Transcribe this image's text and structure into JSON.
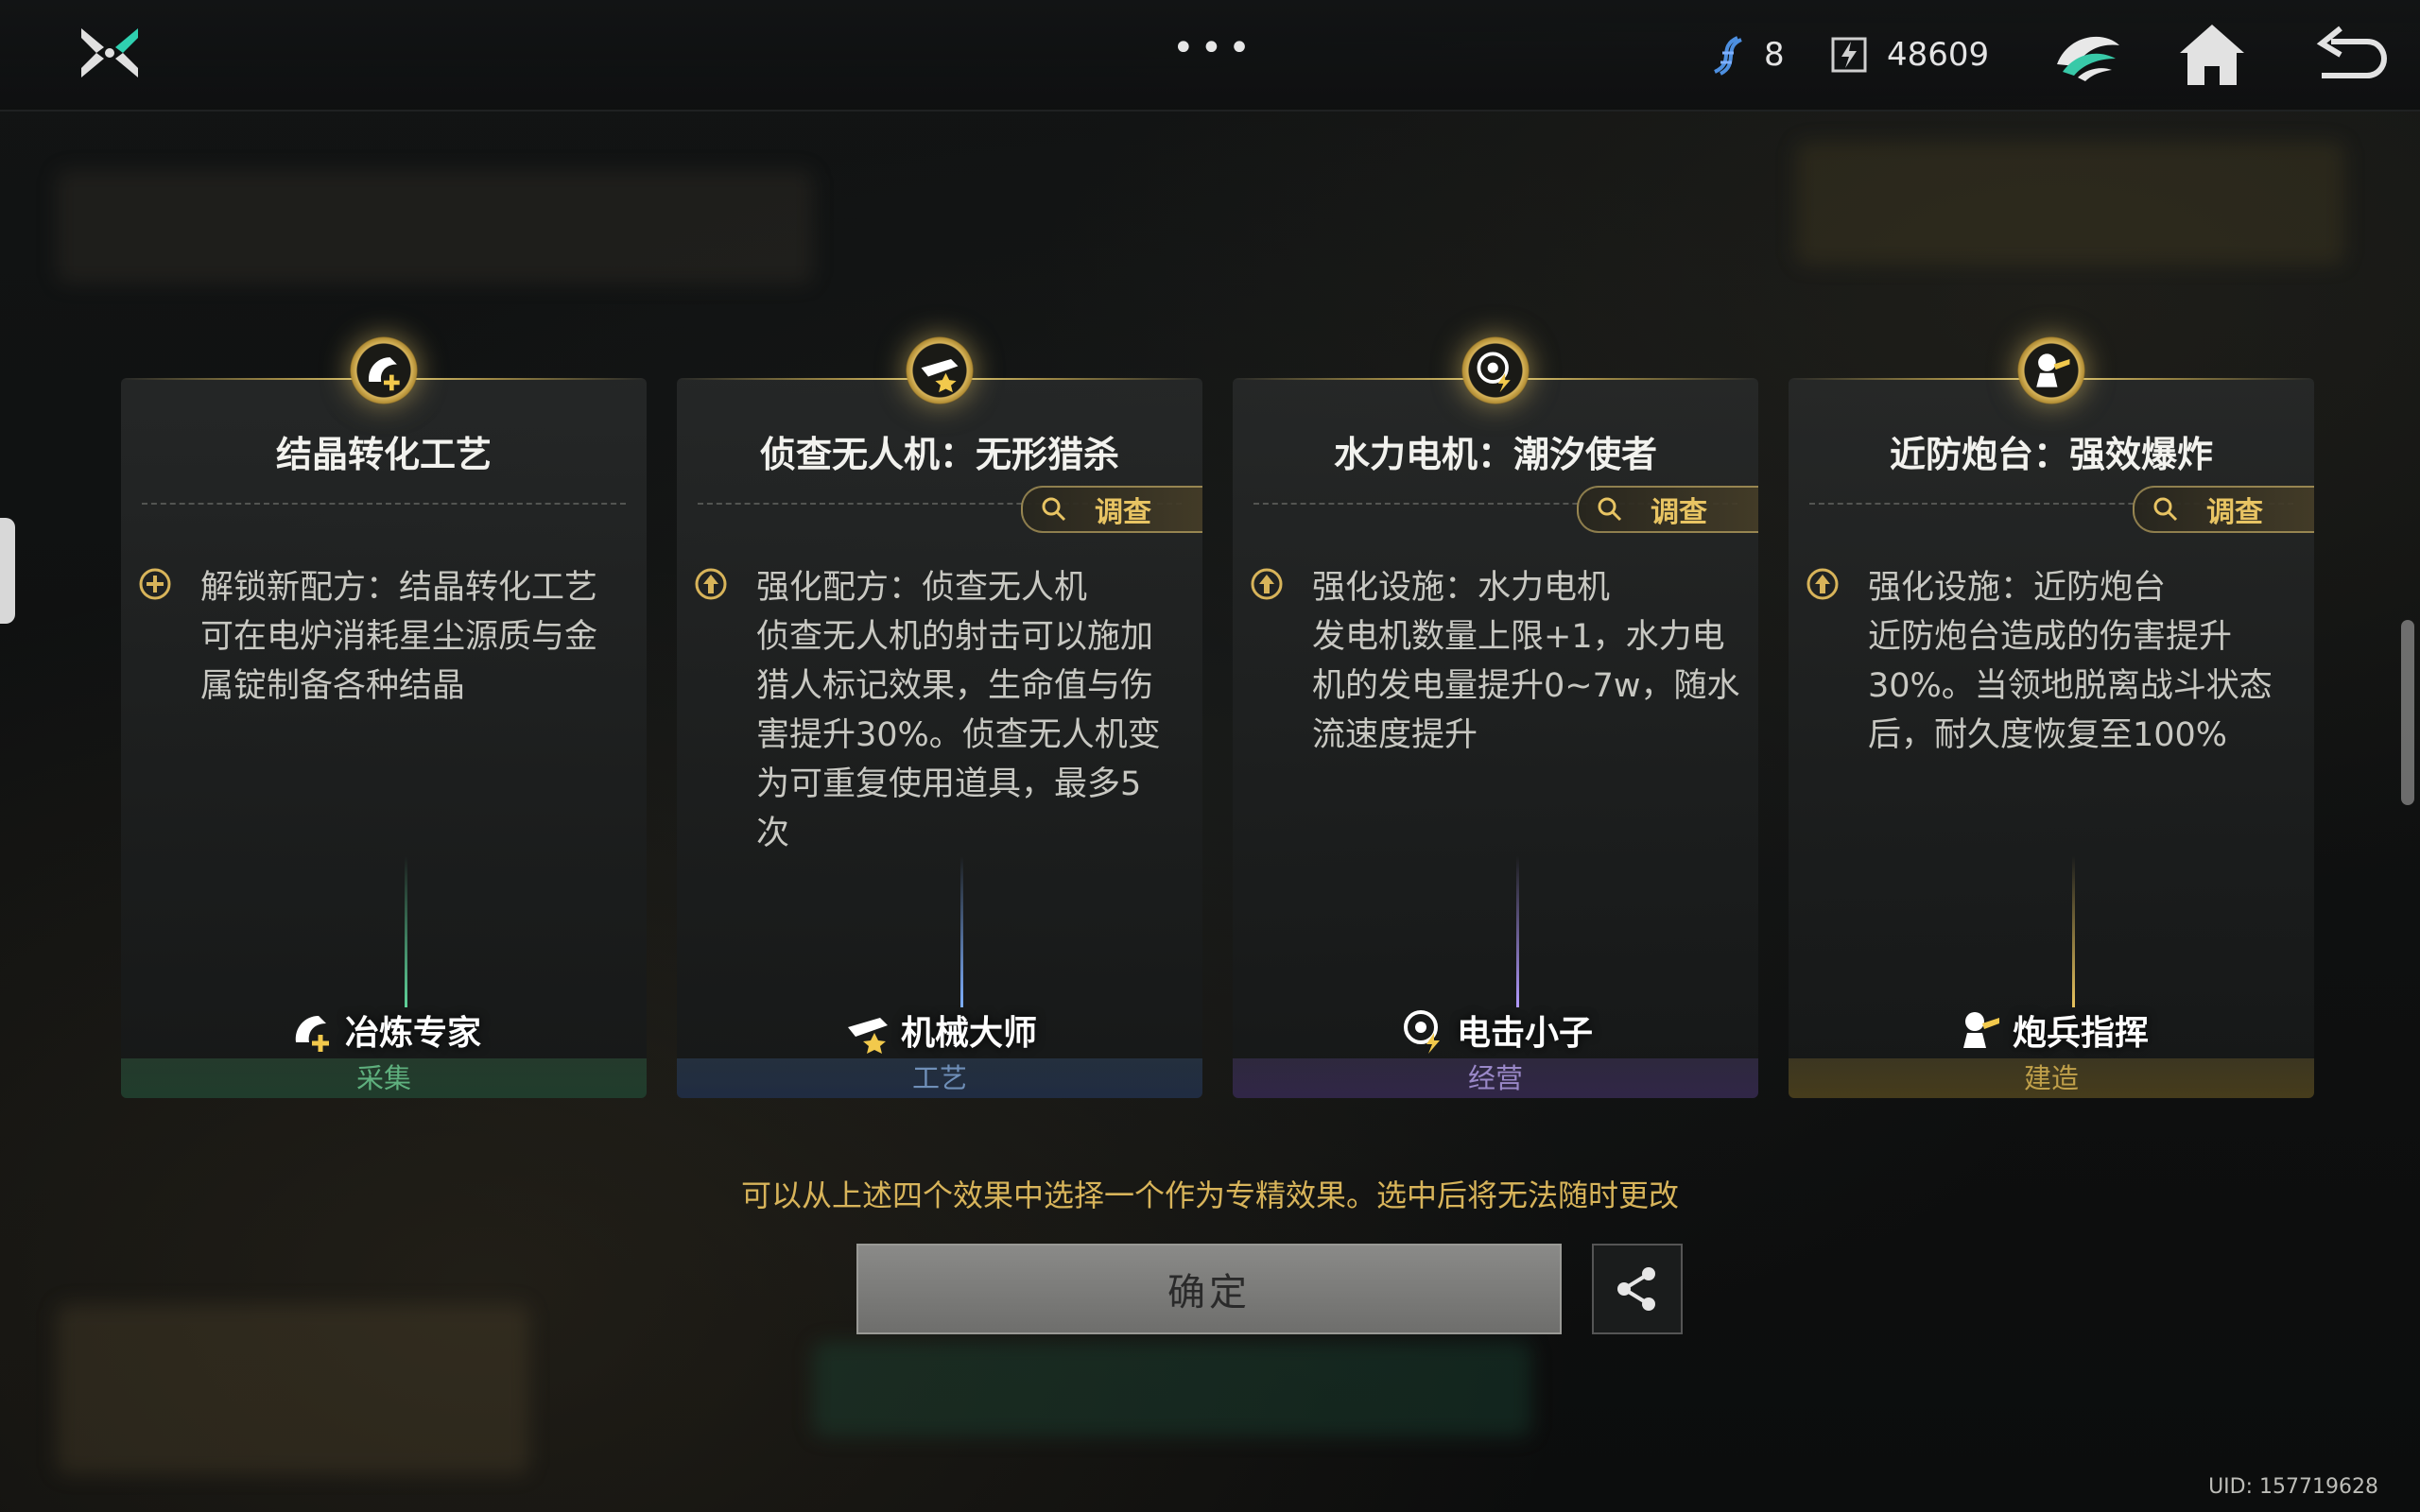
{
  "topbar": {
    "resource1_value": "8",
    "resource1_icon": "dna-icon",
    "resource2_value": "48609",
    "resource2_icon": "energy-icon",
    "more_label": "•••"
  },
  "cards": [
    {
      "title": "结晶转化工艺",
      "has_investigate": false,
      "effect_icon": "unlock-plus-icon",
      "effect_text": "解锁新配方：结晶转化工艺\n可在电炉消耗星尘源质与金\n属锭制备各种结晶",
      "specialist": "冶炼专家",
      "category": "采集",
      "category_color": "#4a9a6a",
      "beam_color": "#5fd39a"
    },
    {
      "title": "侦查无人机：无形猎杀",
      "has_investigate": true,
      "effect_icon": "upgrade-arrow-icon",
      "effect_text": "强化配方：侦查无人机\n侦查无人机的射击可以施加\n猎人标记效果，生命值与伤\n害提升30%。侦查无人机变\n为可重复使用道具，最多5\n次",
      "specialist": "机械大师",
      "category": "工艺",
      "category_color": "#5f7fa8",
      "beam_color": "#7fb0ff"
    },
    {
      "title": "水力电机：潮汐使者",
      "has_investigate": true,
      "effect_icon": "upgrade-arrow-icon",
      "effect_text": "强化设施：水力电机\n发电机数量上限+1，水力电\n机的发电量提升0~7w，随水\n流速度提升",
      "specialist": "电击小子",
      "category": "经营",
      "category_color": "#8a78b8",
      "beam_color": "#b39bff"
    },
    {
      "title": "近防炮台：强效爆炸",
      "has_investigate": true,
      "effect_icon": "upgrade-arrow-icon",
      "effect_text": "强化设施：近防炮台\n近防炮台造成的伤害提升\n30%。当领地脱离战斗状态\n后，耐久度恢复至100%",
      "specialist": "炮兵指挥",
      "category": "建造",
      "category_color": "#b8993f",
      "beam_color": "#e8c45e"
    }
  ],
  "investigate_label": "调查",
  "notice": "可以从上述四个效果中选择一个作为专精效果。选中后将无法随时更改",
  "confirm_label": "确定",
  "uid": "UID: 157719628",
  "colors": {
    "gold_accent": "#e8c463",
    "notice_text": "#d8b45a",
    "confirm_bg": "#7a7a78"
  }
}
